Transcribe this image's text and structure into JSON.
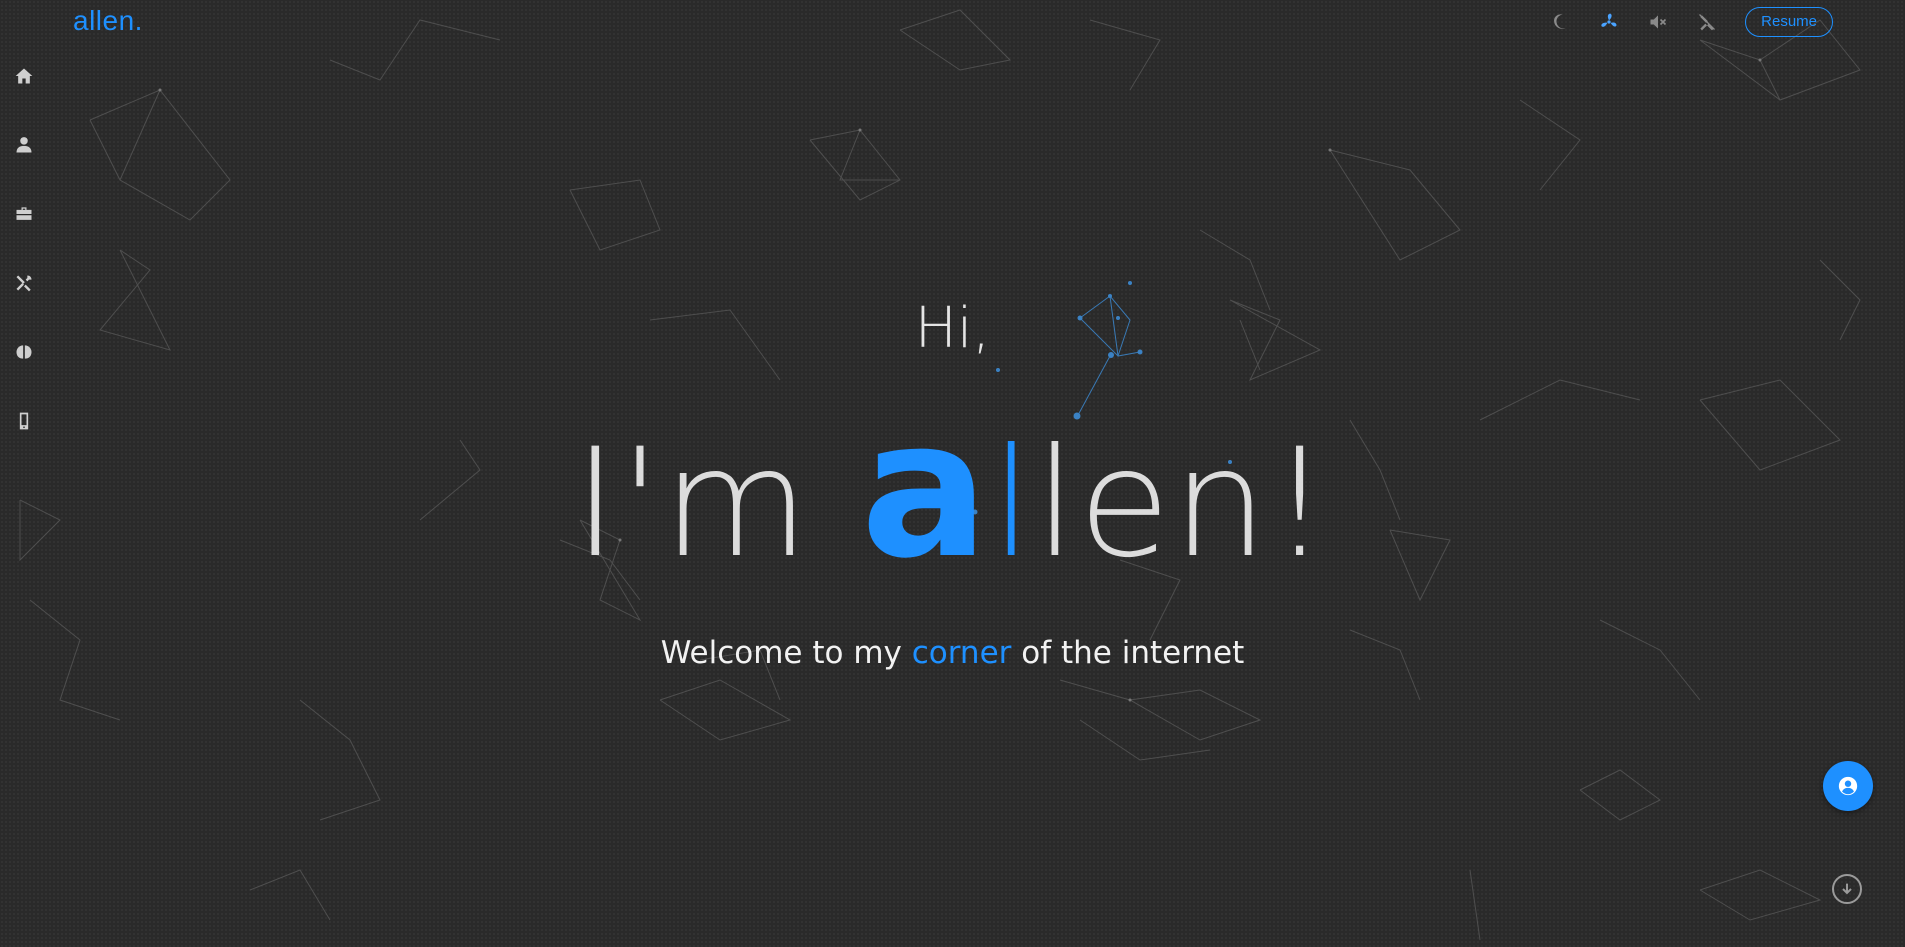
{
  "brand": {
    "logo_text": "allen.",
    "accent_color": "#1e90ff"
  },
  "sidebar": {
    "items": [
      {
        "icon": "home-icon"
      },
      {
        "icon": "user-icon"
      },
      {
        "icon": "briefcase-icon"
      },
      {
        "icon": "tools-icon"
      },
      {
        "icon": "brain-icon"
      },
      {
        "icon": "mobile-icon"
      }
    ]
  },
  "topbar": {
    "icons": [
      "moon-icon",
      "fan-icon",
      "volume-mute-icon",
      "tools-disabled-icon"
    ],
    "resume_label": "Resume"
  },
  "hero": {
    "greeting": "Hi,",
    "name_prefix": "I'm ",
    "name_a": "a",
    "name_l": "l",
    "name_rest": "len!",
    "tagline_start": "Welcome to my ",
    "tagline_accent": "corner",
    "tagline_end": " of the internet"
  },
  "floating": {
    "profile_icon": "user-circle-icon",
    "scroll_icon": "arrow-down-circle-icon"
  },
  "colors": {
    "background": "#2a2a2a",
    "text": "#e0e0e0",
    "accent": "#1e90ff"
  }
}
